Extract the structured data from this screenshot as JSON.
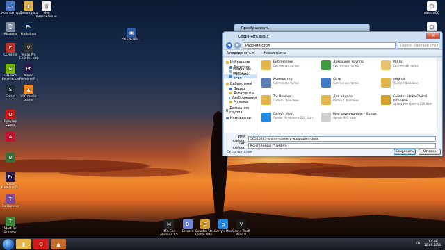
{
  "desktop_icons": [
    {
      "id": "computer",
      "label": "Компьютер",
      "color": "#4a78c2",
      "glyph": "▭"
    },
    {
      "id": "for-videos",
      "label": "Для видоса",
      "color": "#e3b54a",
      "glyph": "▮"
    },
    {
      "id": "my-video",
      "label": "Мое видеоканале...",
      "color": "#f2f2f2",
      "glyph": "▯"
    },
    {
      "id": "recycle",
      "label": "Корзина",
      "color": "#7a8aa0",
      "glyph": "🗑"
    },
    {
      "id": "photoshop",
      "label": "Photoshop",
      "color": "#0d2a4f",
      "glyph": "Ps"
    },
    {
      "id": "ccleaner",
      "label": "CCleaner",
      "color": "#c2332a",
      "glyph": "C"
    },
    {
      "id": "vegas",
      "label": "Vegas Pro 13.0 (64-bit)",
      "color": "#333333",
      "glyph": "V"
    },
    {
      "id": "geforce",
      "label": "GeForce Experience",
      "color": "#76b900",
      "glyph": "G"
    },
    {
      "id": "premiere",
      "label": "Adobe Premiere P...",
      "color": "#2a1a4a",
      "glyph": "Pr"
    },
    {
      "id": "steam",
      "label": "Steam",
      "color": "#1b2838",
      "glyph": "S"
    },
    {
      "id": "vlc",
      "label": "VLC media player",
      "color": "#f08a24",
      "glyph": "▲"
    },
    {
      "id": "opera",
      "label": "Браузер Opera",
      "color": "#d01a1a",
      "glyph": "O"
    },
    {
      "id": "adobe-reader",
      "label": "",
      "color": "#c8102e",
      "glyph": "A"
    },
    {
      "id": "cs-settings",
      "label": "",
      "color": "#3a6e3a",
      "glyph": "⚙"
    },
    {
      "id": "adobe-premiere2",
      "label": "Adobe Premiere P...",
      "color": "#2a1a4a",
      "glyph": "Pr"
    },
    {
      "id": "tor",
      "label": "Tor Browser",
      "color": "#7e4798",
      "glyph": "T"
    },
    {
      "id": "start-tor",
      "label": "Start Tor Browser",
      "color": "#3f8a3f",
      "glyph": "T"
    },
    {
      "id": "nvidia",
      "label": "nVanceGO",
      "color": "#ffffff",
      "glyph": "▢"
    },
    {
      "id": "yandex",
      "label": "",
      "color": "#ffffff",
      "glyph": "▢"
    },
    {
      "id": "file-sk",
      "label": "56546283...",
      "color": "#2f5ea8",
      "glyph": "▣"
    },
    {
      "id": "mta",
      "label": "MTA San Andreas 1.5",
      "color": "#222222",
      "glyph": "M"
    },
    {
      "id": "discord",
      "label": "Discord",
      "color": "#7289da",
      "glyph": "D"
    },
    {
      "id": "cs-go",
      "label": "Counter-Str... Global Offe...",
      "color": "#d6a12a",
      "glyph": "C"
    },
    {
      "id": "gmod",
      "label": "Garry's Mod",
      "color": "#1e88e5",
      "glyph": "g"
    },
    {
      "id": "gta5",
      "label": "Grand Theft Auto V",
      "color": "#1a1a1a",
      "glyph": "V"
    }
  ],
  "back_dialog": {
    "title": "Преобразовать"
  },
  "window": {
    "title": "Сохранить файл",
    "address": "Рабочий стол",
    "search_placeholder": "Поиск: Рабочий стол",
    "toolbar": {
      "organize": "Упорядочить ▾",
      "new_folder": "Новая папка"
    },
    "nav": [
      {
        "label": "Избранное",
        "color": "#e8b730",
        "level": 0
      },
      {
        "label": "Загрузки",
        "color": "#3e7cc9",
        "level": 1
      },
      {
        "label": "Недавние места",
        "color": "#7fa5d0",
        "level": 1
      },
      {
        "label": "Рабочий стол",
        "color": "#3e7cc9",
        "level": 1,
        "selected": true
      },
      {
        "label": "",
        "gap": true
      },
      {
        "label": "Библиотеки",
        "color": "#e3b54a",
        "level": 0
      },
      {
        "label": "Видео",
        "color": "#3a6fbd",
        "level": 1
      },
      {
        "label": "Документы",
        "color": "#e3b54a",
        "level": 1
      },
      {
        "label": "Изображения",
        "color": "#6cb0e6",
        "level": 1
      },
      {
        "label": "Музыка",
        "color": "#e3b54a",
        "level": 1
      },
      {
        "label": "",
        "gap": true
      },
      {
        "label": "Домашняя группа",
        "color": "#3e9a3e",
        "level": 0
      },
      {
        "label": "",
        "gap": true
      },
      {
        "label": "Компьютер",
        "color": "#5a7fb5",
        "level": 0
      }
    ],
    "files": [
      {
        "name": "Библиотеки",
        "sub": "Системная папка",
        "color": "#e3b54a"
      },
      {
        "name": "Домашняя группа",
        "sub": "Системная папка",
        "color": "#3e9a3e"
      },
      {
        "name": "MIRI's",
        "sub": "Системная папка",
        "color": "#e8c36a"
      },
      {
        "name": "Компьютер",
        "sub": "Системная папка",
        "color": "#5a7fb5"
      },
      {
        "name": "Сеть",
        "sub": "Системная папка",
        "color": "#3e7cc9"
      },
      {
        "name": "original",
        "sub": "Папка с файлами",
        "color": "#e3b54a"
      },
      {
        "name": "Tor Browser",
        "sub": "Папка с файлами",
        "color": "#e3b54a"
      },
      {
        "name": "Для видоса",
        "sub": "Папка с файлами",
        "color": "#e3b54a"
      },
      {
        "name": "Counter-Strike Global Offensive",
        "sub": "Ярлык Интернета 220 байт",
        "color": "#d6a12a"
      },
      {
        "name": "Garry's Mod",
        "sub": "Ярлык Интернета 220 байт",
        "color": "#1e88e5"
      },
      {
        "name": "Мое видеоканале - Ярлык",
        "sub": "Ярлык 987 байт",
        "color": "#cfcfcf"
      }
    ],
    "filename_label": "Имя файла:",
    "filename_value": "56546283-anime-scenery-wallpapers-dusk",
    "filetype_label": "Тип файла:",
    "filetype_value": "Контейнеры (*.webm)",
    "hide_folders": "Скрыть папки",
    "save_button": "Сохранить",
    "cancel_button": "Отмена"
  },
  "taskbar": {
    "apps": [
      {
        "id": "explorer",
        "color": "#e3b54a",
        "glyph": "▮"
      },
      {
        "id": "opera",
        "color": "#d01a1a",
        "glyph": "O"
      },
      {
        "id": "converter",
        "color": "#c46a2a",
        "glyph": "▲"
      }
    ],
    "lang": "EN",
    "time": "12:29",
    "date": "12.09.2016"
  }
}
